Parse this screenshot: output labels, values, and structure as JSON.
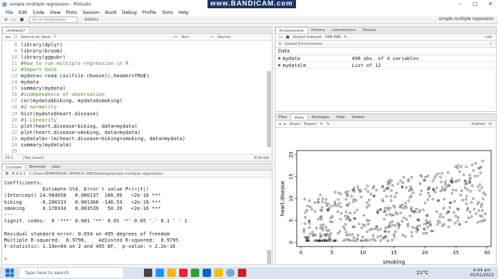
{
  "window": {
    "title": "simple multiple regression - RStudio",
    "watermark": "www.BANDICAM.com"
  },
  "menu": [
    "File",
    "Edit",
    "Code",
    "View",
    "Plots",
    "Session",
    "Build",
    "Debug",
    "Profile",
    "Tools",
    "Help"
  ],
  "toolbar": {
    "goto": "Go to file/function",
    "addins": "Addins",
    "project": "simple multiple regression"
  },
  "editor": {
    "tab": "Untitled1*",
    "toolbar": {
      "source_on_save": "Source on Save",
      "run": "Run",
      "source": "Source"
    },
    "lines": [
      {
        "n": "8",
        "t": "library(dplyr)",
        "c": ""
      },
      {
        "n": "9",
        "t": "library(broom)",
        "c": ""
      },
      {
        "n": "10",
        "t": "library(ggpubr)",
        "c": ""
      },
      {
        "n": "11",
        "t": "#How to run multiple regression in R",
        "c": "cm"
      },
      {
        "n": "12",
        "t": "#Import data",
        "c": "cm"
      },
      {
        "n": "13",
        "t": "mydata<-read.csv(file.choose(),header=TRUE)",
        "c": ""
      },
      {
        "n": "14",
        "t": "mydata",
        "c": ""
      },
      {
        "n": "15",
        "t": "summary(mydata)",
        "c": ""
      },
      {
        "n": "16",
        "t": "#independence of observation",
        "c": "cm"
      },
      {
        "n": "17",
        "t": "cor(mydata$biking, mydata$smoking)",
        "c": ""
      },
      {
        "n": "18",
        "t": "#2 normality",
        "c": "cm"
      },
      {
        "n": "19",
        "t": "hist(mydata$heart.disease)",
        "c": ""
      },
      {
        "n": "20",
        "t": "#3 Linearity",
        "c": "cm"
      },
      {
        "n": "21",
        "t": "plot(heart.disease~biking, data=mydata)",
        "c": ""
      },
      {
        "n": "22",
        "t": "plot(heart.disease~smoking, data=mydata)",
        "c": ""
      },
      {
        "n": "23",
        "t": "mydatalm<-lm(heart.disease~biking+smoking, data=mydata)",
        "c": ""
      },
      {
        "n": "24",
        "t": "summary(mydatalm)",
        "c": ""
      },
      {
        "n": "25",
        "t": "",
        "c": ""
      }
    ],
    "status_pos": "25:1",
    "status_level": "(Top Level)",
    "status_type": "R Script"
  },
  "console": {
    "tabs": [
      "Console",
      "Terminal",
      "Jobs"
    ],
    "version": "R 4.2.1",
    "path": "C:/Users/EMMANUEL PATRICK IWE/Desktop/simple multiple regression/",
    "lines": [
      "Coefficients:",
      "             Estimate Std. Error t value Pr(>|t|)    ",
      "(Intercept) 14.984658   0.080137  186.99   <2e-16 ***",
      "biking      -0.200133   0.001366 -146.53   <2e-16 ***",
      "smoking      0.178334   0.003539   50.39   <2e-16 ***",
      "---",
      "Signif. codes:  0 '***' 0.001 '**' 0.01 '*' 0.05 '.' 0.1 ' ' 1",
      "",
      "Residual standard error: 0.654 on 495 degrees of freedom",
      "Multiple R-squared:  0.9796,\tAdjusted R-squared:  0.9795 ",
      "F-statistic: 1.19e+04 on 2 and 495 DF,  p-value: < 2.2e-16",
      "",
      "> "
    ]
  },
  "env": {
    "tabs": [
      "Environment",
      "History",
      "Connections",
      "Tutorial"
    ],
    "toolbar": {
      "import": "Import Dataset",
      "mem": "498 MiB",
      "list": "List"
    },
    "scope": "Global Environment",
    "section": "Data",
    "rows": [
      {
        "name": "mydata",
        "value": "498 obs. of 4 variables"
      },
      {
        "name": "mydatalm",
        "value": "List of  12"
      }
    ]
  },
  "plots": {
    "tabs": [
      "Files",
      "Plots",
      "Packages",
      "Help",
      "Viewer"
    ],
    "toolbar": {
      "zoom": "Zoom",
      "export": "Export",
      "publish": "Publish"
    }
  },
  "chart_data": {
    "type": "scatter",
    "xlabel": "smoking",
    "ylabel": "heart.disease",
    "xlim": [
      0,
      30
    ],
    "ylim": [
      0,
      20
    ],
    "xticks": [
      0,
      5,
      10,
      15,
      20,
      25,
      30
    ],
    "yticks": [
      0,
      5,
      10,
      15,
      20
    ],
    "point_count": 498,
    "grid": false
  },
  "taskbar": {
    "search": "Type here to search",
    "weather": "21°C",
    "time": "6:44 am",
    "date": "05/01/2023"
  }
}
